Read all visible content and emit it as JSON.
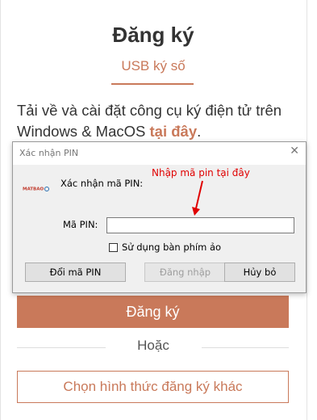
{
  "page": {
    "title": "Đăng ký",
    "tab_label": "USB ký số",
    "intro_text": "Tải về và cài đặt công cụ ký điện tử trên Windows & MacOS ",
    "intro_link": "tại đây",
    "intro_suffix": ".",
    "register_button": "Đăng ký",
    "or_text": "Hoặc",
    "other_method_button": "Chọn hình thức đăng ký khác"
  },
  "dialog": {
    "title": "Xác nhận PIN",
    "close_glyph": "✕",
    "logo_text": "MATBAO",
    "confirm_label": "Xác nhận mã PIN:",
    "hint_text": "Nhập mã pin tại đây",
    "pin_label": "Mã PIN:",
    "pin_value": "",
    "virtual_keyboard_label": "Sử dụng bàn phím ảo",
    "virtual_keyboard_checked": false,
    "buttons": {
      "change_pin": "Đổi mã PIN",
      "login": "Đăng nhập",
      "cancel": "Hủy bỏ"
    }
  },
  "colors": {
    "accent": "#c9795a",
    "hint": "#e00000"
  }
}
